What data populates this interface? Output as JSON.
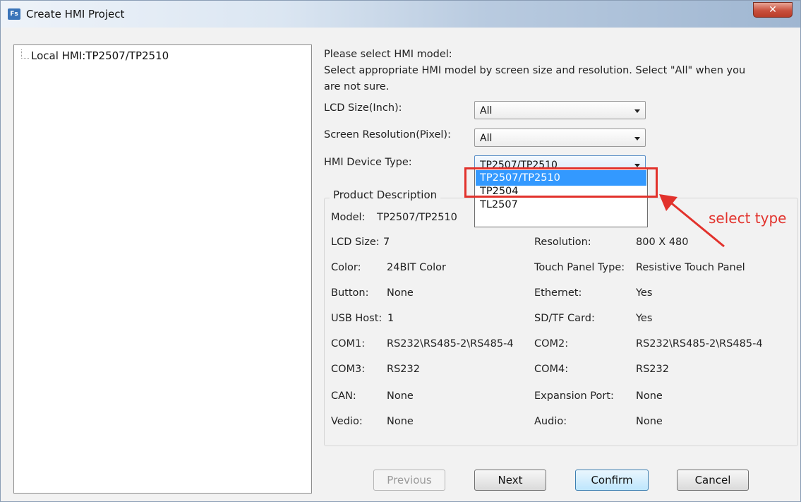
{
  "window": {
    "title": "Create HMI Project",
    "icon_label": "Fs",
    "close_glyph": "✕"
  },
  "tree": {
    "item": "Local HMI:TP2507/TP2510"
  },
  "intro": {
    "line1": "Please select HMI model:",
    "line2": "Select appropriate HMI model by screen size and resolution. Select \"All\" when you",
    "line3": "are not sure."
  },
  "fields": {
    "lcd_label": "LCD Size(Inch):",
    "lcd_value": "All",
    "res_label": "Screen Resolution(Pixel):",
    "res_value": "All",
    "type_label": "HMI Device Type:",
    "type_value": "TP2507/TP2510"
  },
  "dropdown": {
    "options": [
      "TP2507/TP2510",
      "TP2504",
      "TL2507"
    ],
    "selected": "TP2507/TP2510"
  },
  "product": {
    "legend": "Product Description",
    "model_label": "Model:",
    "model_value": "TP2507/TP2510",
    "rows": [
      {
        "l1": "LCD Size:",
        "v1": "7",
        "l2": "Resolution:",
        "v2": "800 X 480"
      },
      {
        "l1": "Color:",
        "v1": "24BIT Color",
        "l2": "Touch Panel Type:",
        "v2": "Resistive Touch Panel"
      },
      {
        "l1": "Button:",
        "v1": "None",
        "l2": "Ethernet:",
        "v2": "Yes"
      },
      {
        "l1": "USB Host:",
        "v1": "1",
        "l2": "SD/TF Card:",
        "v2": "Yes"
      },
      {
        "l1": "COM1:",
        "v1": "RS232\\RS485-2\\RS485-4",
        "l2": "COM2:",
        "v2": "RS232\\RS485-2\\RS485-4"
      },
      {
        "l1": "COM3:",
        "v1": "RS232",
        "l2": "COM4:",
        "v2": "RS232"
      },
      {
        "l1": "CAN:",
        "v1": "None",
        "l2": "Expansion Port:",
        "v2": "None"
      },
      {
        "l1": "Vedio:",
        "v1": "None",
        "l2": "Audio:",
        "v2": "None"
      }
    ]
  },
  "annotation": {
    "text": "select type",
    "color": "#e2322c"
  },
  "buttons": {
    "previous": "Previous",
    "next": "Next",
    "confirm": "Confirm",
    "cancel": "Cancel"
  },
  "colors": {
    "selection": "#3399ff",
    "default_button": "#bee6fd"
  }
}
